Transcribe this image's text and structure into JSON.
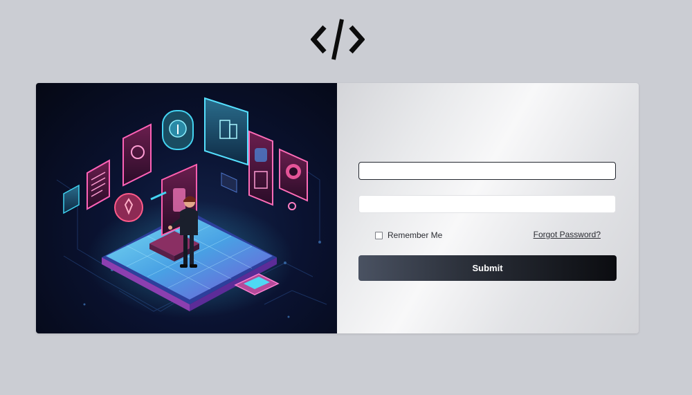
{
  "logo": {
    "icon": "code-brackets-icon"
  },
  "illustration": {
    "subject": "isometric-tech-illustration"
  },
  "form": {
    "username": {
      "value": "",
      "placeholder": ""
    },
    "password": {
      "value": "",
      "placeholder": ""
    },
    "remember_label": "Remember Me",
    "remember_checked": false,
    "forgot_label": "Forgot Password?",
    "submit_label": "Submit"
  },
  "colors": {
    "page_background": "#cbcdd3",
    "button_dark": "#0b0c10",
    "button_light": "#4a5262",
    "neon_cyan": "#44d4f2",
    "neon_magenta": "#d23c8c"
  }
}
